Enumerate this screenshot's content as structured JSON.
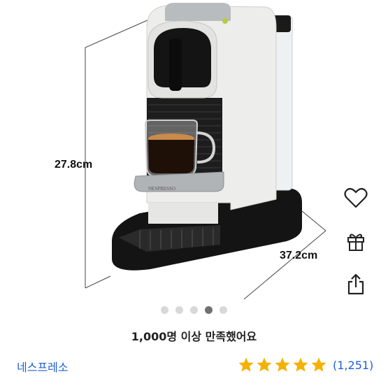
{
  "product": {
    "height_label": "27.8cm",
    "depth_label": "37.2cm",
    "brand_print": "NESPRESSO"
  },
  "actions": {
    "icons": [
      "heart-icon",
      "gift-icon",
      "share-icon"
    ]
  },
  "carousel": {
    "count": 5,
    "active_index": 3
  },
  "satisfaction_text": "1,000명 이상 만족했어요",
  "brand_name": "네스프레소",
  "rating": {
    "stars": 5,
    "count_text": "(1,251)",
    "star_color": "#f5b100"
  },
  "colors": {
    "link": "#1e5fd6",
    "dot_active": "#707070",
    "dot_inactive": "#d8d8d8"
  }
}
